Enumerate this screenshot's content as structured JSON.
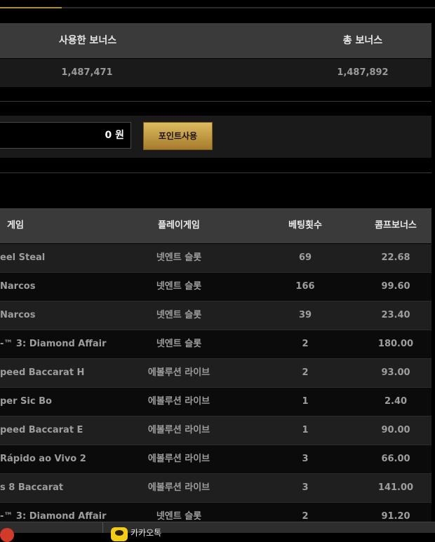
{
  "bonus_summary": {
    "used_label": "사용한 보너스",
    "total_label": "총 보너스",
    "used_value": "1,487,471",
    "total_value": "1,487,892"
  },
  "points": {
    "value": "0 원",
    "use_button": "포인트사용"
  },
  "table": {
    "headers": [
      "게임",
      "플레이게임",
      "베팅횟수",
      "콤프보너스"
    ],
    "rows": [
      [
        "eel Steal",
        "넷엔트 슬롯",
        "69",
        "22.68"
      ],
      [
        "Narcos",
        "넷엔트 슬롯",
        "166",
        "99.60"
      ],
      [
        "Narcos",
        "넷엔트 슬롯",
        "39",
        "23.40"
      ],
      [
        "-™ 3: Diamond Affair",
        "넷엔트 슬롯",
        "2",
        "180.00"
      ],
      [
        "peed Baccarat H",
        "에볼루션 라이브",
        "2",
        "93.00"
      ],
      [
        "per Sic Bo",
        "에볼루션 라이브",
        "1",
        "2.40"
      ],
      [
        "peed Baccarat E",
        "에볼루션 라이브",
        "1",
        "90.00"
      ],
      [
        "Rápido ao Vivo 2",
        "에볼루션 라이브",
        "3",
        "66.00"
      ],
      [
        "s 8 Baccarat",
        "에볼루션 라이브",
        "3",
        "141.00"
      ],
      [
        "-™ 3: Diamond Affair",
        "넷엔트 슬롯",
        "2",
        "91.20"
      ]
    ]
  },
  "taskbar": {
    "app_label": "카카오톡"
  },
  "icons": {
    "taskbar_left": "chrome-icon",
    "taskbar_right": "kakaotalk-icon"
  },
  "colors": {
    "accent_gold": "#b08d3a",
    "button_gold": "#ddbb60"
  }
}
